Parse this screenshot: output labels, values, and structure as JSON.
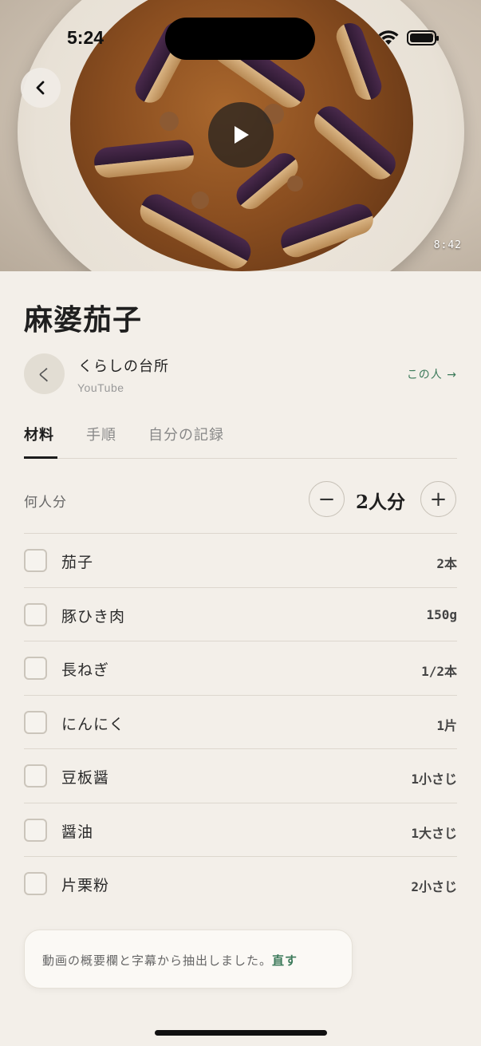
{
  "status_bar": {
    "time": "5:24"
  },
  "video": {
    "duration": "8:42"
  },
  "recipe": {
    "title": "麻婆茄子"
  },
  "author": {
    "avatar_glyph": "く",
    "name": "くらしの台所",
    "source": "YouTube",
    "link_label": "この人 →"
  },
  "tabs": [
    {
      "label": "材料",
      "active": true
    },
    {
      "label": "手順",
      "active": false
    },
    {
      "label": "自分の記録",
      "active": false
    }
  ],
  "servings": {
    "label": "何人分",
    "value": "2人分",
    "minus": "−",
    "plus": "+"
  },
  "ingredients": [
    {
      "name": "茄子",
      "qty": "2本",
      "checked": false
    },
    {
      "name": "豚ひき肉",
      "qty": "150g",
      "checked": false
    },
    {
      "name": "長ねぎ",
      "qty": "1/2本",
      "checked": false
    },
    {
      "name": "にんにく",
      "qty": "1片",
      "checked": false
    },
    {
      "name": "豆板醤",
      "qty": "1小さじ",
      "checked": false
    },
    {
      "name": "醤油",
      "qty": "1大さじ",
      "checked": false
    },
    {
      "name": "片栗粉",
      "qty": "2小さじ",
      "checked": false
    }
  ],
  "note": {
    "text": "動画の概要欄と字幕から抽出しました。",
    "link": "直す"
  },
  "colors": {
    "accent": "#3c7a5a",
    "background": "#f3efe9"
  }
}
